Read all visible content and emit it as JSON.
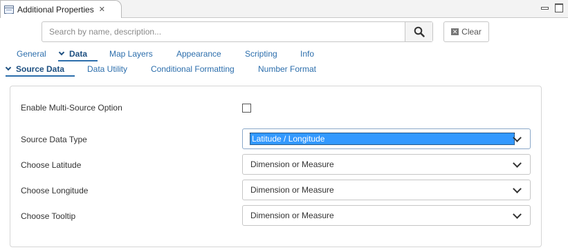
{
  "view": {
    "title": "Additional Properties",
    "close_icon": "✕",
    "minimize_icon": "minimize-icon",
    "maximize_icon": "maximize-icon"
  },
  "search": {
    "placeholder": "Search by name, description...",
    "value": "",
    "clear_label": "Clear"
  },
  "main_tabs": [
    {
      "label": "General",
      "active": false
    },
    {
      "label": "Data",
      "active": true
    },
    {
      "label": "Map Layers",
      "active": false
    },
    {
      "label": "Appearance",
      "active": false
    },
    {
      "label": "Scripting",
      "active": false
    },
    {
      "label": "Info",
      "active": false
    }
  ],
  "sub_tabs": [
    {
      "label": "Source Data",
      "active": true
    },
    {
      "label": "Data Utility",
      "active": false
    },
    {
      "label": "Conditional Formatting",
      "active": false
    },
    {
      "label": "Number Format",
      "active": false
    }
  ],
  "form": {
    "multi_source": {
      "label": "Enable Multi-Source Option",
      "checked": false
    },
    "source_data_type": {
      "label": "Source Data Type",
      "value": "Latitude / Longitude"
    },
    "latitude": {
      "label": "Choose Latitude",
      "value": "Dimension or Measure"
    },
    "longitude": {
      "label": "Choose Longitude",
      "value": "Dimension or Measure"
    },
    "tooltip": {
      "label": "Choose Tooltip",
      "value": "Dimension or Measure"
    }
  },
  "colors": {
    "link": "#2c6eac",
    "active_tab": "#1d4f80",
    "selection": "#3399ff"
  }
}
